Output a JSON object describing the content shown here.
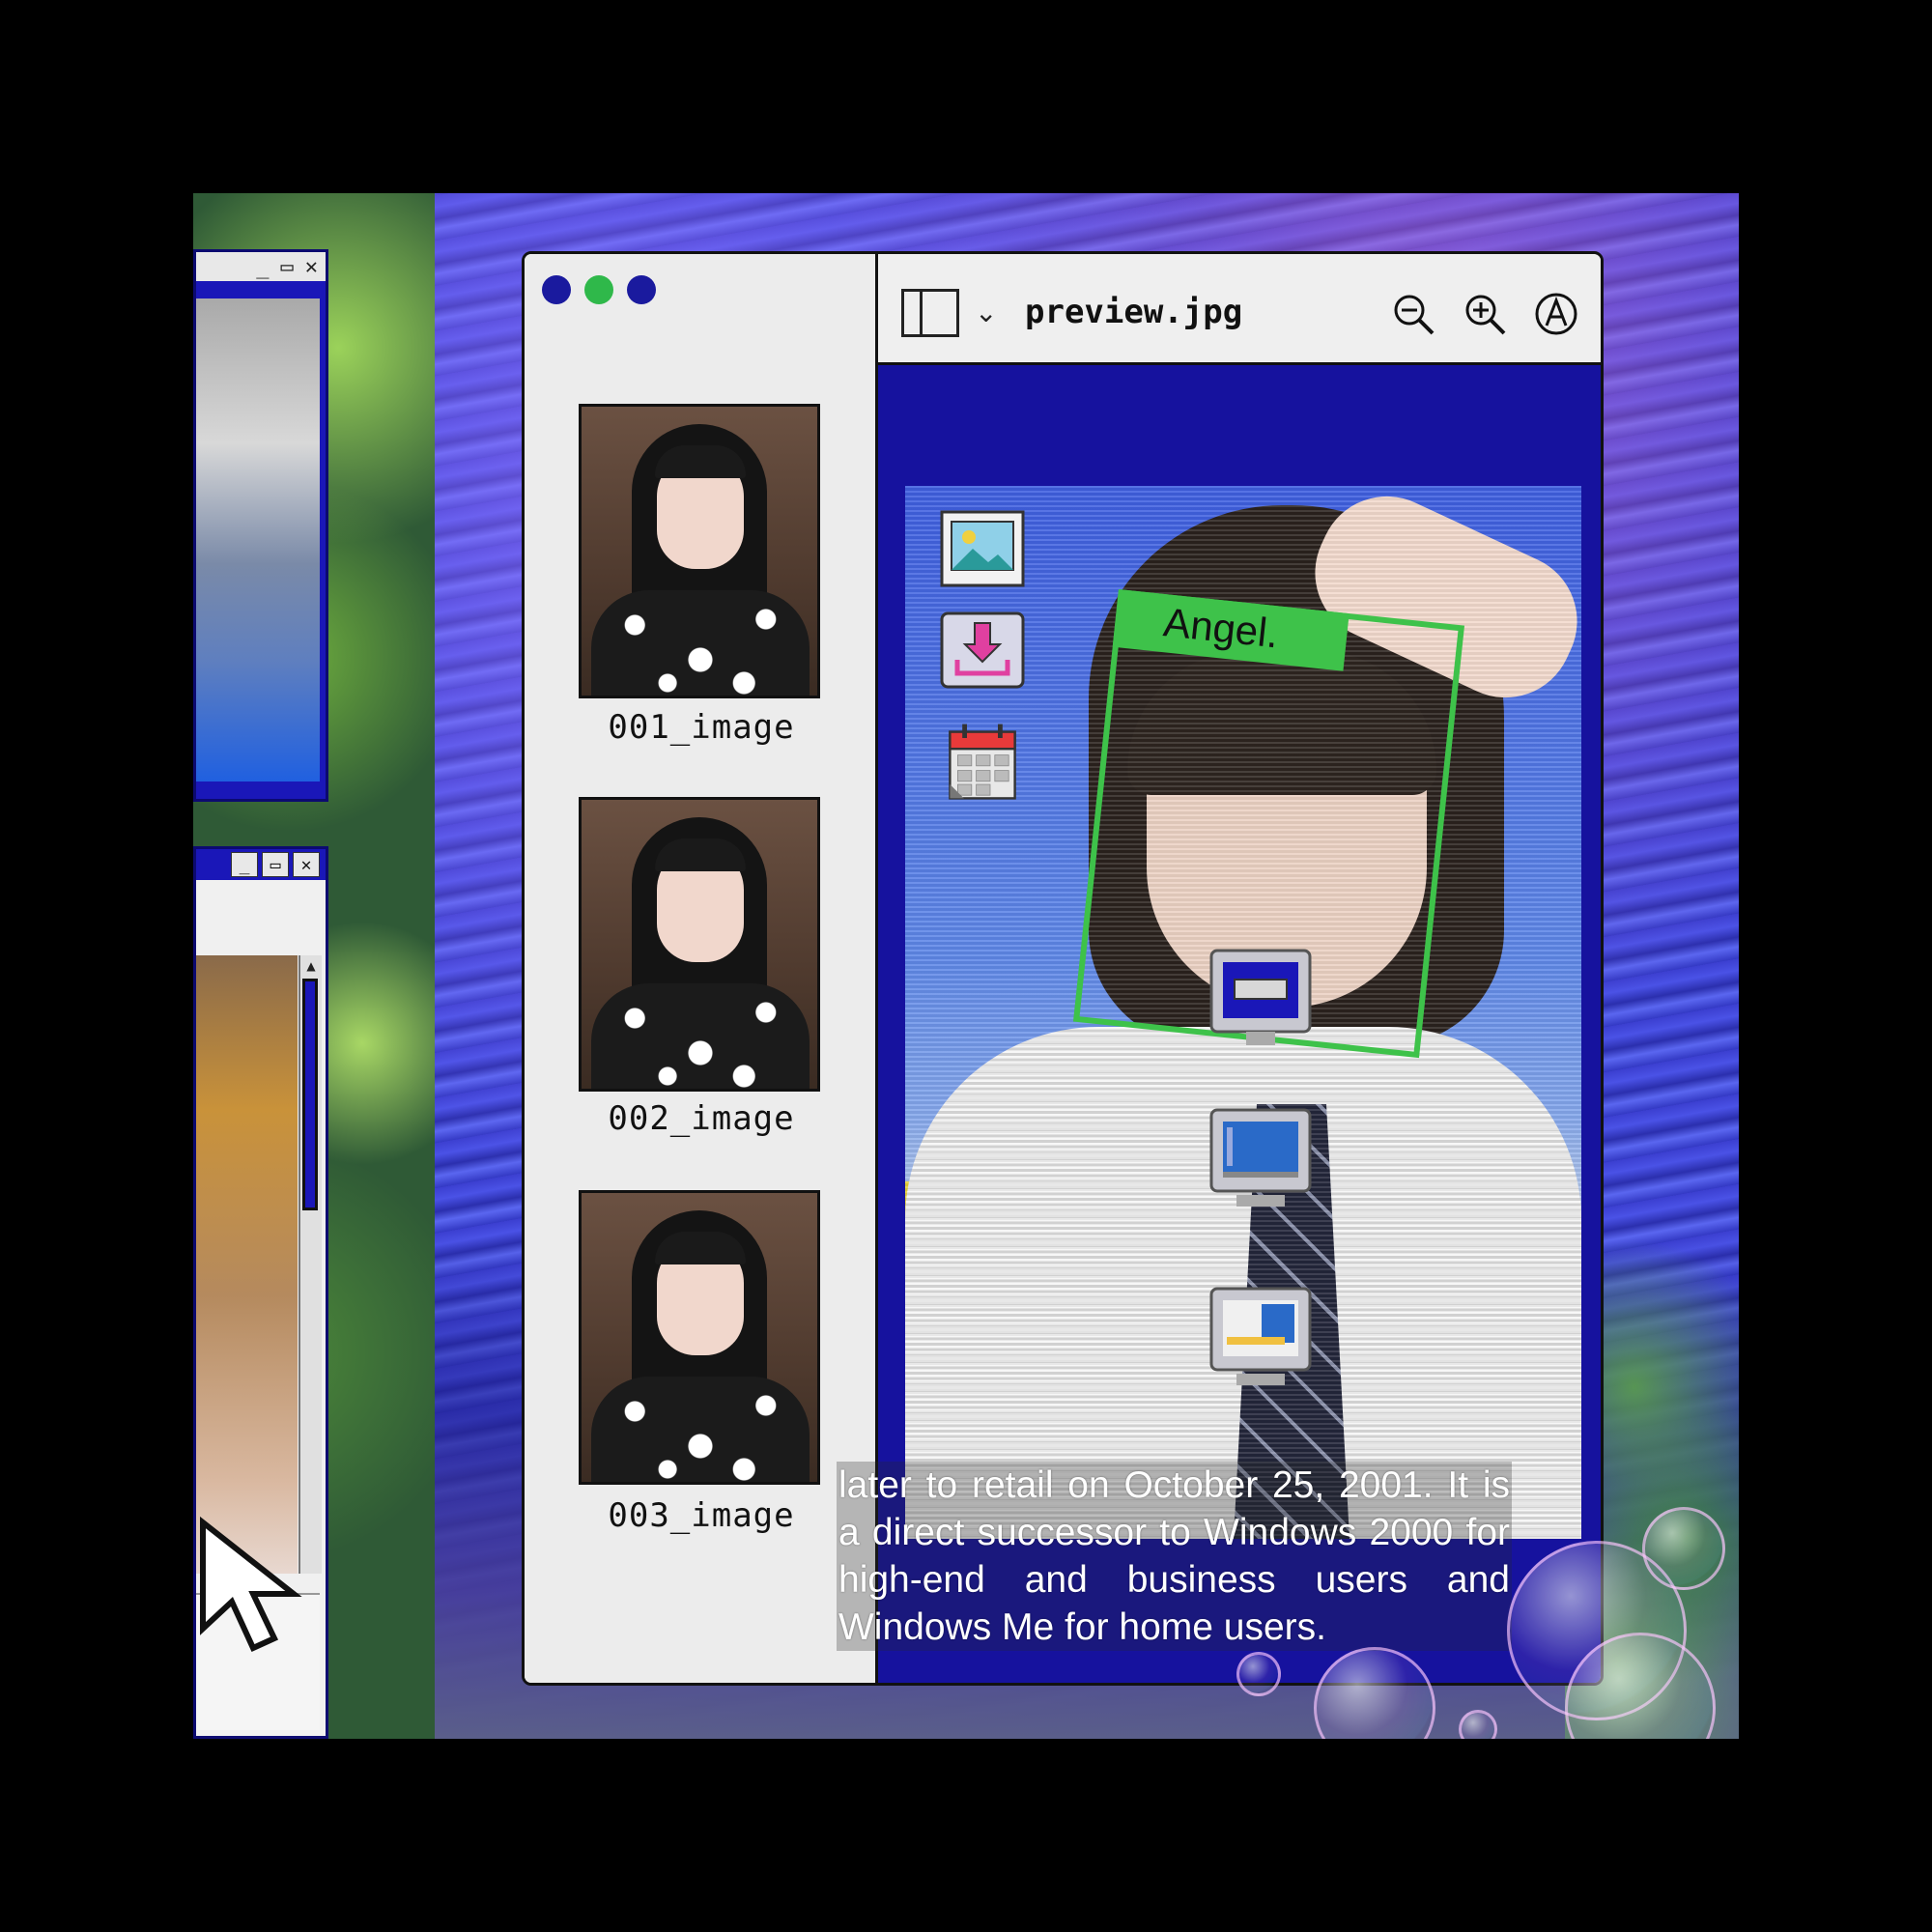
{
  "main_window": {
    "filename": "preview.jpg",
    "traffic_lights": [
      "#1a1a9e",
      "#2fb84a",
      "#1a1a9e"
    ],
    "toolbar": {
      "layout_icon": "sidebar-layout-icon",
      "dropdown_icon": "chevron-down-icon",
      "tools": [
        "zoom-out-icon",
        "zoom-in-icon",
        "annotate-icon"
      ]
    },
    "thumbnails": [
      {
        "label": "001_image"
      },
      {
        "label": "002_image"
      },
      {
        "label": "003_image"
      }
    ],
    "preview": {
      "detection_label": "Angel.",
      "detection_color": "#3ec24a",
      "side_tools": [
        "image-icon",
        "download-icon",
        "calendar-icon"
      ]
    }
  },
  "desktop_icons": [
    "keyboard-monitor-icon",
    "monitor-icon",
    "window-monitor-icon"
  ],
  "left_windows": {
    "top_controls": [
      "_",
      "▭",
      "✕"
    ],
    "bottom_controls": [
      "_",
      "▭",
      "✕"
    ]
  },
  "caption": "later to retail on October 25, 2001. It is a direct successor to Windows 2000 for high-end and business users and Windows Me for home users.",
  "colors": {
    "accent": "#16129e",
    "frame": "#111111",
    "panel": "#efefef"
  }
}
